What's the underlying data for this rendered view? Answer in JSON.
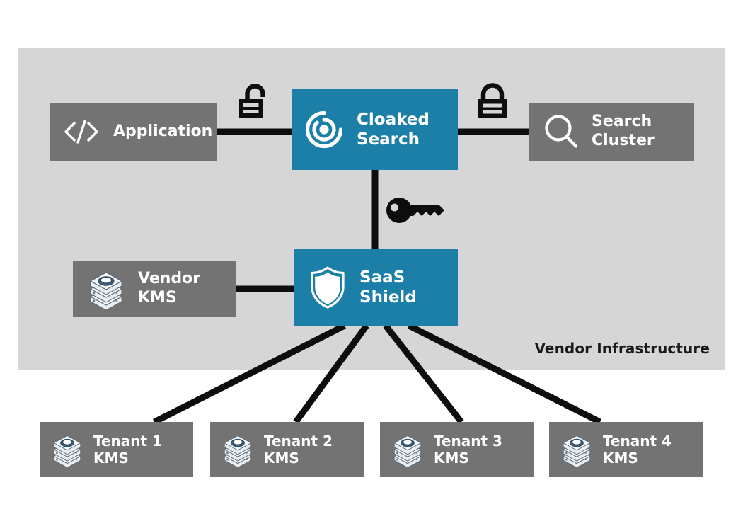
{
  "diagram": {
    "title": "Cloaked Search / SaaS Shield vendor infrastructure architecture",
    "colors": {
      "teal": "#1c7fa8",
      "gray_box": "#737373",
      "panel_bg": "#d6d6d6",
      "page_bg": "#ffffff",
      "line": "#0d0d0d",
      "text_on_box": "#ffffff",
      "text_dark": "#1a1a1a"
    }
  },
  "panel": {
    "label": "Vendor Infrastructure"
  },
  "nodes": {
    "application": {
      "label": "Application",
      "icon": "code-brackets-icon",
      "style": "gray"
    },
    "cloaked_search": {
      "label": "Cloaked\nSearch",
      "icon": "cloaked-search-logo-icon",
      "style": "teal"
    },
    "search_cluster": {
      "label": "Search\nCluster",
      "icon": "magnifier-icon",
      "style": "gray"
    },
    "vendor_kms": {
      "label": "Vendor\nKMS",
      "icon": "server-stack-icon",
      "style": "gray"
    },
    "saas_shield": {
      "label": "SaaS\nShield",
      "icon": "shield-icon",
      "style": "teal"
    }
  },
  "tenants": [
    {
      "label": "Tenant 1\nKMS",
      "icon": "server-stack-icon"
    },
    {
      "label": "Tenant 2\nKMS",
      "icon": "server-stack-icon"
    },
    {
      "label": "Tenant 3\nKMS",
      "icon": "server-stack-icon"
    },
    {
      "label": "Tenant 4\nKMS",
      "icon": "server-stack-icon"
    }
  ],
  "badges": [
    {
      "name": "unlocked-padlock-icon",
      "meaning": "unencrypted link"
    },
    {
      "name": "locked-padlock-icon",
      "meaning": "encrypted link"
    },
    {
      "name": "key-icon",
      "meaning": "key material link"
    }
  ],
  "connections": [
    {
      "from": "application",
      "to": "cloaked_search",
      "badge": "unlocked-padlock-icon"
    },
    {
      "from": "cloaked_search",
      "to": "search_cluster",
      "badge": "locked-padlock-icon"
    },
    {
      "from": "cloaked_search",
      "to": "saas_shield",
      "badge": "key-icon"
    },
    {
      "from": "vendor_kms",
      "to": "saas_shield",
      "badge": null
    },
    {
      "from": "saas_shield",
      "to": "tenant-1",
      "badge": null
    },
    {
      "from": "saas_shield",
      "to": "tenant-2",
      "badge": null
    },
    {
      "from": "saas_shield",
      "to": "tenant-3",
      "badge": null
    },
    {
      "from": "saas_shield",
      "to": "tenant-4",
      "badge": null
    }
  ]
}
